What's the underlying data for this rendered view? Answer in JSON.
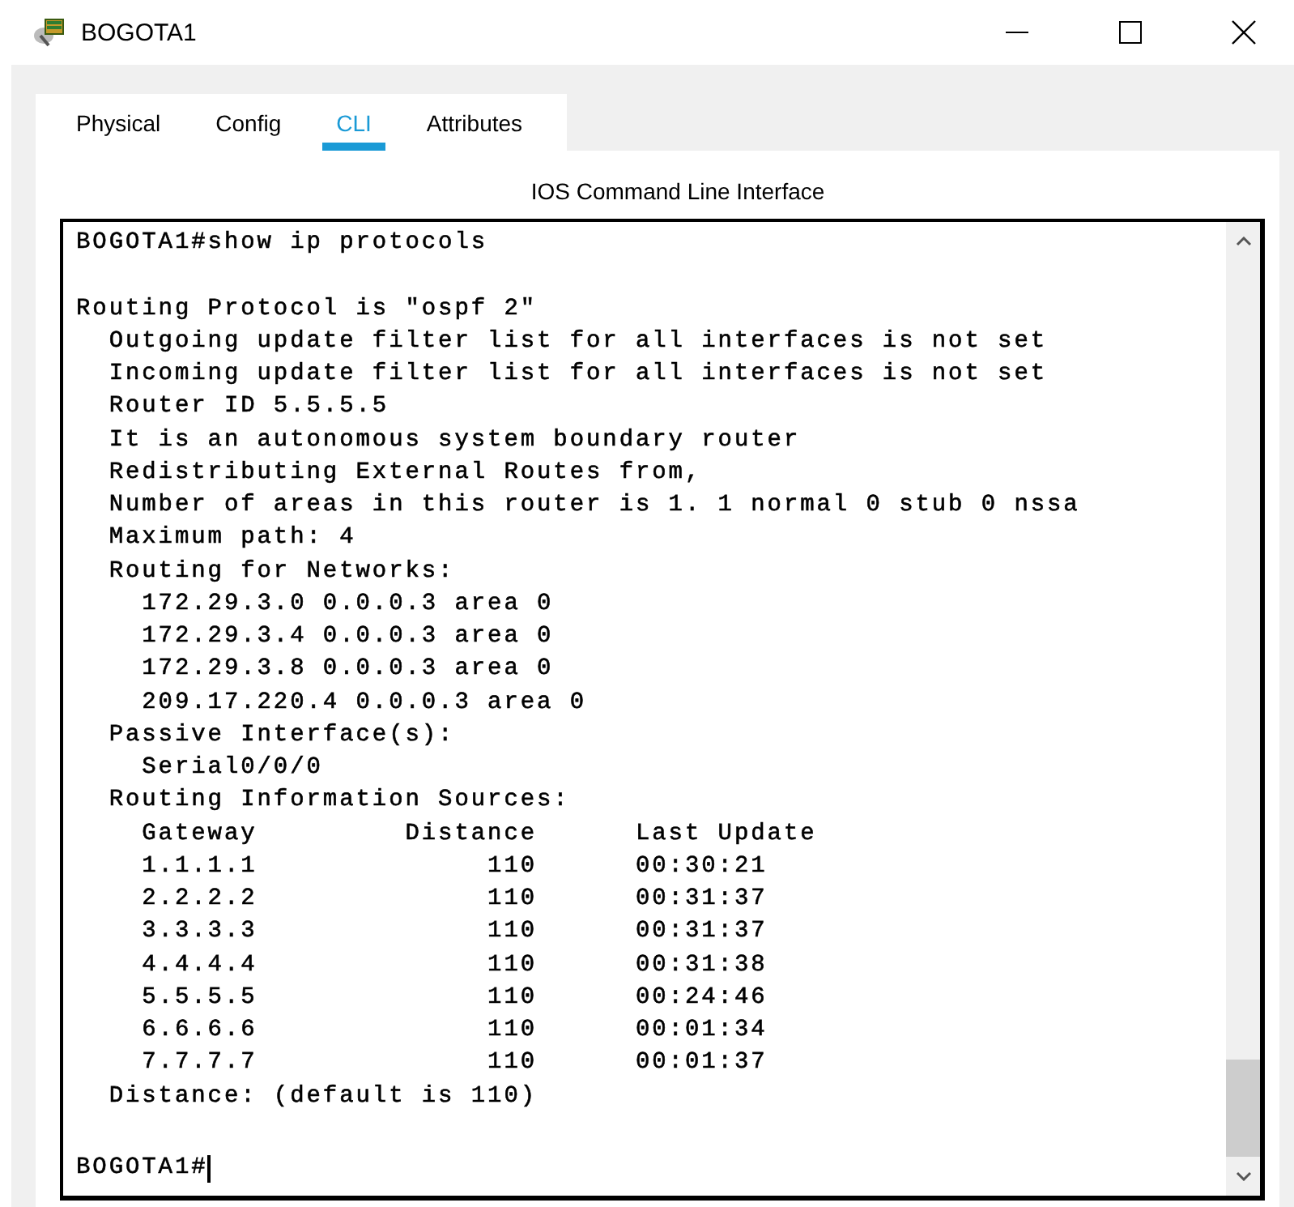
{
  "window": {
    "title": "BOGOTA1"
  },
  "tabs": [
    {
      "label": "Physical",
      "selected": false
    },
    {
      "label": "Config",
      "selected": false
    },
    {
      "label": "CLI",
      "selected": true
    },
    {
      "label": "Attributes",
      "selected": false
    }
  ],
  "panel_title": "IOS Command Line Interface",
  "terminal": {
    "lines": [
      {
        "kind": "text",
        "text": "BOGOTA1#show ip protocols"
      },
      {
        "kind": "blank"
      },
      {
        "kind": "text",
        "text": "Routing Protocol is \"ospf 2\""
      },
      {
        "kind": "text",
        "text": "  Outgoing update filter list for all interfaces is not set"
      },
      {
        "kind": "text",
        "text": "  Incoming update filter list for all interfaces is not set"
      },
      {
        "kind": "text",
        "text": "  Router ID 5.5.5.5"
      },
      {
        "kind": "text",
        "text": "  It is an autonomous system boundary router"
      },
      {
        "kind": "text",
        "text": "  Redistributing External Routes from,"
      },
      {
        "kind": "text",
        "text": "  Number of areas in this router is 1. 1 normal 0 stub 0 nssa"
      },
      {
        "kind": "text",
        "text": "  Maximum path: 4"
      },
      {
        "kind": "text",
        "text": "  Routing for Networks:"
      },
      {
        "kind": "text",
        "text": "    172.29.3.0 0.0.0.3 area 0"
      },
      {
        "kind": "text",
        "text": "    172.29.3.4 0.0.0.3 area 0"
      },
      {
        "kind": "text",
        "text": "    172.29.3.8 0.0.0.3 area 0"
      },
      {
        "kind": "text",
        "text": "    209.17.220.4 0.0.0.3 area 0"
      },
      {
        "kind": "text",
        "text": "  Passive Interface(s):"
      },
      {
        "kind": "text",
        "text": "    Serial0/0/0"
      },
      {
        "kind": "text",
        "text": "  Routing Information Sources:"
      },
      {
        "kind": "text",
        "text": "    Gateway         Distance      Last Update"
      },
      {
        "kind": "text",
        "text": "    1.1.1.1              110      00:30:21"
      },
      {
        "kind": "text",
        "text": "    2.2.2.2              110      00:31:37"
      },
      {
        "kind": "text",
        "text": "    3.3.3.3              110      00:31:37"
      },
      {
        "kind": "text",
        "text": "    4.4.4.4              110      00:31:38"
      },
      {
        "kind": "text",
        "text": "    5.5.5.5              110      00:24:46"
      },
      {
        "kind": "text",
        "text": "    6.6.6.6              110      00:01:34"
      },
      {
        "kind": "text",
        "text": "    7.7.7.7              110      00:01:37"
      },
      {
        "kind": "text",
        "text": "  Distance: (default is 110)"
      },
      {
        "kind": "blank"
      }
    ],
    "prompt": "BOGOTA1#"
  }
}
